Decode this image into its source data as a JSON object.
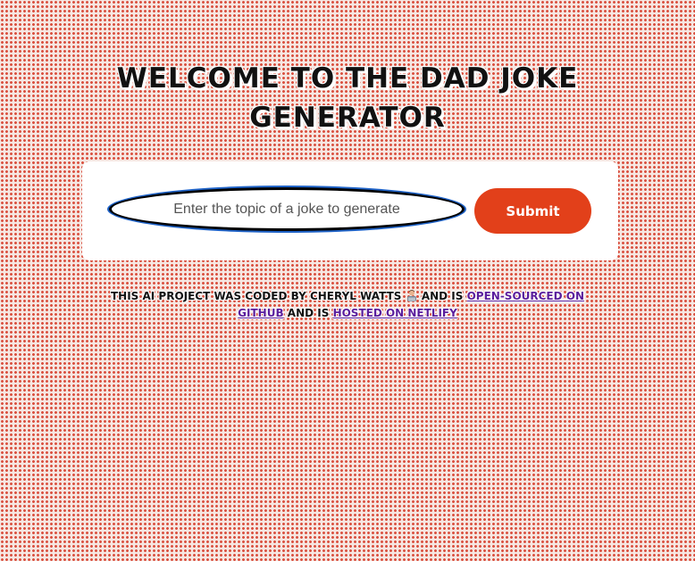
{
  "header": {
    "title_line1": "WELCOME TO THE DAD JOKE",
    "title_line2": "GENERATOR"
  },
  "form": {
    "input_placeholder": "Enter the topic of a joke to generate",
    "input_value": "",
    "submit_label": "Submit"
  },
  "footer": {
    "text_before": "This AI project was coded by Cheryl Watts",
    "emoji_icon": "technologist-icon",
    "text_and_is_1": "and is",
    "github_link_text": "open-sourced on GitHub",
    "text_and_is_2": "and is",
    "netlify_link_text": "hosted on Netlify"
  },
  "colors": {
    "background_dots": "#d9503f",
    "button": "#e2401a",
    "link": "#5a1d9c",
    "input_focus_ring": "#1e62c7"
  }
}
